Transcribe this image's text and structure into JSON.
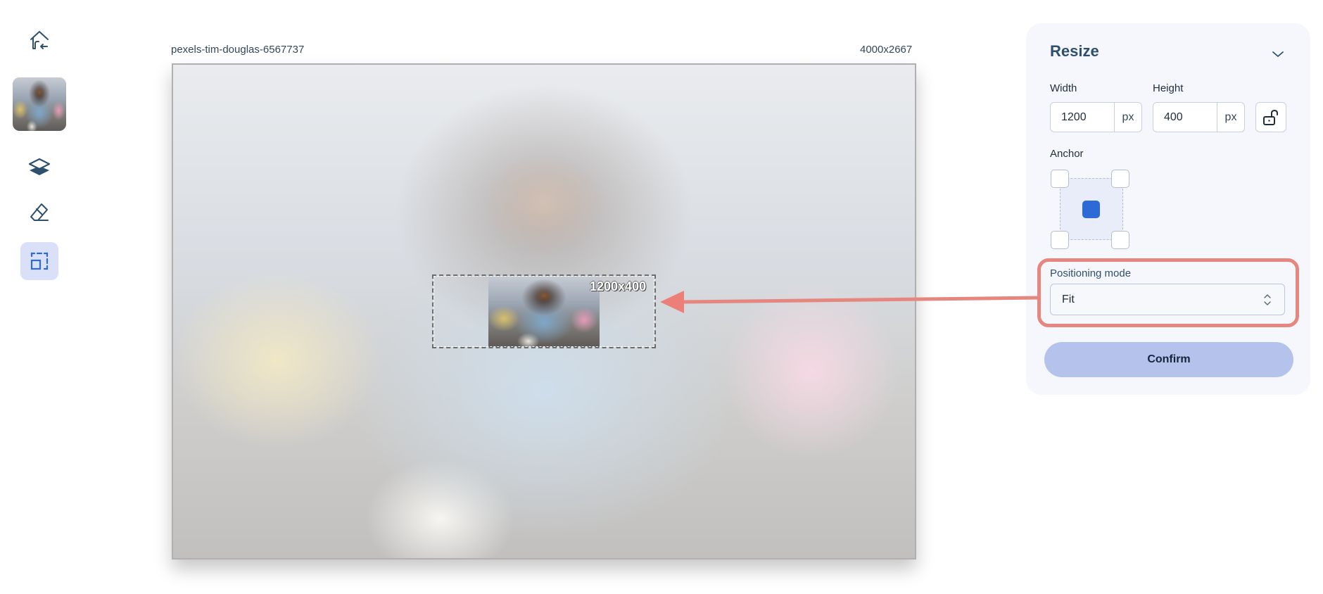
{
  "sidebar": {
    "items": [
      {
        "name": "home",
        "icon": "home-back-icon",
        "active": false
      },
      {
        "name": "image-thumbnail",
        "icon": "image-thumbnail",
        "active": false
      },
      {
        "name": "layers",
        "icon": "layers-icon",
        "active": false
      },
      {
        "name": "eraser",
        "icon": "eraser-icon",
        "active": false
      },
      {
        "name": "resize",
        "icon": "resize-icon",
        "active": true
      }
    ]
  },
  "canvas": {
    "filename": "pexels-tim-douglas-6567737",
    "dimensions": "4000x2667",
    "crop_label": "1200x400"
  },
  "panel": {
    "title": "Resize",
    "collapse_icon": "chevron-down-icon",
    "width_label": "Width",
    "width_value": "1200",
    "width_unit": "px",
    "height_label": "Height",
    "height_value": "400",
    "height_unit": "px",
    "lock_icon": "unlock-icon",
    "aspect_locked": false,
    "anchor_label": "Anchor",
    "anchor_selected": "center",
    "positioning_label": "Positioning mode",
    "positioning_value": "Fit",
    "confirm_label": "Confirm"
  },
  "annotation": {
    "color": "#e5877f",
    "target": "positioning-mode-select"
  },
  "colors": {
    "accent": "#2c6bd6",
    "active_nav_bg": "#d9e0f7",
    "confirm_bg": "#b5c3ec",
    "title_color": "#2e506c"
  }
}
